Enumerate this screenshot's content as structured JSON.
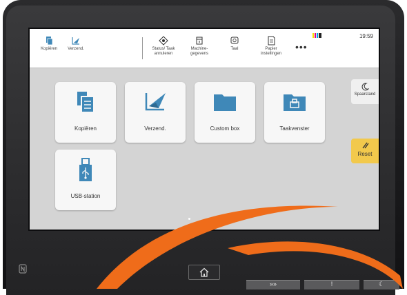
{
  "topbar": {
    "items": [
      {
        "label": "Kopiëren",
        "icon": "copy-icon"
      },
      {
        "label": "Verzend.",
        "icon": "send-icon"
      },
      {
        "label1": "Status/ Taak",
        "label2": "annuleren",
        "icon": "status-icon"
      },
      {
        "label1": "Machine-",
        "label2": "gegevens",
        "icon": "machine-info-icon"
      },
      {
        "label": "Taal",
        "icon": "language-icon"
      },
      {
        "label1": "Papier",
        "label2": "instellingen",
        "icon": "paper-settings-icon"
      }
    ],
    "more": "•••",
    "clock": "19:59",
    "toner_colors": [
      "#f3e200",
      "#e6007e",
      "#00a0e9",
      "#222222"
    ]
  },
  "tiles": [
    {
      "label": "Kopiëren",
      "icon": "copy-icon"
    },
    {
      "label": "Verzend.",
      "icon": "send-icon"
    },
    {
      "label": "Custom box",
      "icon": "folder-icon"
    },
    {
      "label": "Taakvenster",
      "icon": "job-box-icon"
    },
    {
      "label": "USB-station",
      "icon": "usb-icon"
    }
  ],
  "side": {
    "sleep_label": "Spaarstand",
    "reset_label": "Reset"
  },
  "hardware": {
    "nfc": "N",
    "start_symbol": "»»",
    "attention_symbol": "!",
    "power_symbol": "☾"
  },
  "colors": {
    "accent_blue": "#3f88b8",
    "reset_yellow": "#f2c94c",
    "swoosh_orange": "#ef6c1a"
  }
}
